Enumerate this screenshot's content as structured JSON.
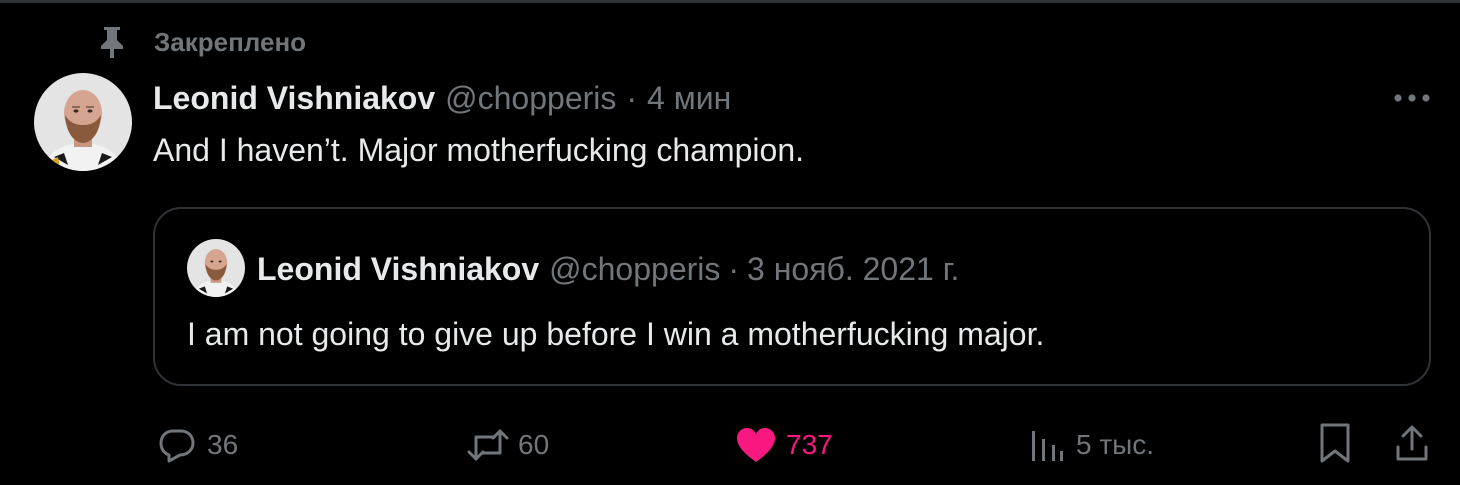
{
  "pinned": {
    "label": "Закреплено",
    "icon": "pin-icon"
  },
  "tweet": {
    "author_name": "Leonid Vishniakov",
    "handle": "@chopperis",
    "separator": "·",
    "time": "4 мин",
    "text": "And I haven’t. Major motherfucking champion.",
    "more_icon": "more-dots-icon"
  },
  "quote": {
    "author_name": "Leonid Vishniakov",
    "handle": "@chopperis",
    "separator": "·",
    "time": "3 нояб. 2021 г.",
    "text": "I am not going to give up before I win a motherfucking major."
  },
  "actions": {
    "reply": {
      "count": "36",
      "icon": "reply-icon"
    },
    "retweet": {
      "count": "60",
      "icon": "retweet-icon"
    },
    "like": {
      "count": "737",
      "icon": "heart-icon",
      "liked": true
    },
    "views": {
      "count": "5 тыс.",
      "icon": "views-icon"
    },
    "bookmark": {
      "icon": "bookmark-icon"
    },
    "share": {
      "icon": "share-icon"
    }
  },
  "colors": {
    "background": "#000000",
    "text_primary": "#e7e9ea",
    "text_secondary": "#71767b",
    "border": "#2f3336",
    "like_active": "#f91880"
  }
}
